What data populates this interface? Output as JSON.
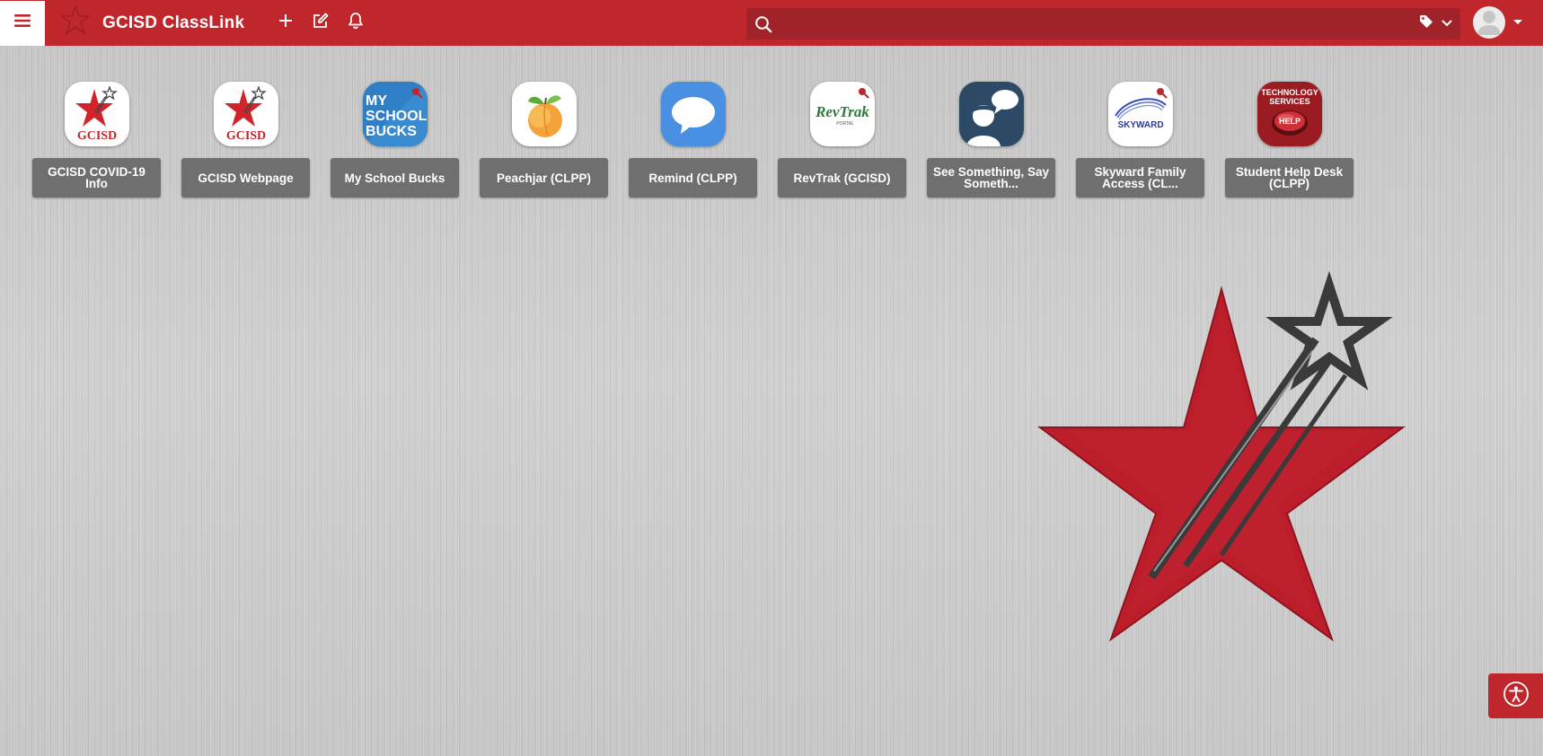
{
  "header": {
    "brand_name": "GCISD ClassLink",
    "search": {
      "placeholder": "",
      "value": ""
    },
    "icons": [
      "menu-icon",
      "plus-icon",
      "edit-icon",
      "bell-icon",
      "search-icon",
      "tag-icon",
      "chevron-down-icon",
      "user-avatar-icon"
    ]
  },
  "apps": [
    {
      "label": "GCISD COVID-19 Info",
      "icon": "gcisd-star-logo"
    },
    {
      "label": "GCISD Webpage",
      "icon": "gcisd-star-logo"
    },
    {
      "label": "My School Bucks",
      "icon": "my-school-bucks-logo",
      "icon_text": "MY SCHOOL BUCKS"
    },
    {
      "label": "Peachjar (CLPP)",
      "icon": "peach-logo"
    },
    {
      "label": "Remind (CLPP)",
      "icon": "chat-bubble-logo"
    },
    {
      "label": "RevTrak (GCISD)",
      "icon": "revtrak-logo",
      "icon_text": "RevTrak",
      "icon_subtext": "PORTAL"
    },
    {
      "label": "See Something, Say Someth...",
      "icon": "person-speech-logo"
    },
    {
      "label": "Skyward Family Access (CL...",
      "icon": "skyward-logo",
      "icon_text": "SKYWARD"
    },
    {
      "label": "Student Help Desk (CLPP)",
      "icon": "tech-services-help-logo",
      "icon_text": "TECHNOLOGY SERVICES",
      "icon_subtext": "HELP"
    }
  ],
  "logo_text": "GCISD",
  "colors": {
    "brand_red": "#c0272d",
    "search_bg": "#9f2328",
    "label_bg": "#6f6f6f",
    "star_dark": "#3a3a3a"
  },
  "accessibility_button": {
    "icon": "accessibility-icon"
  }
}
